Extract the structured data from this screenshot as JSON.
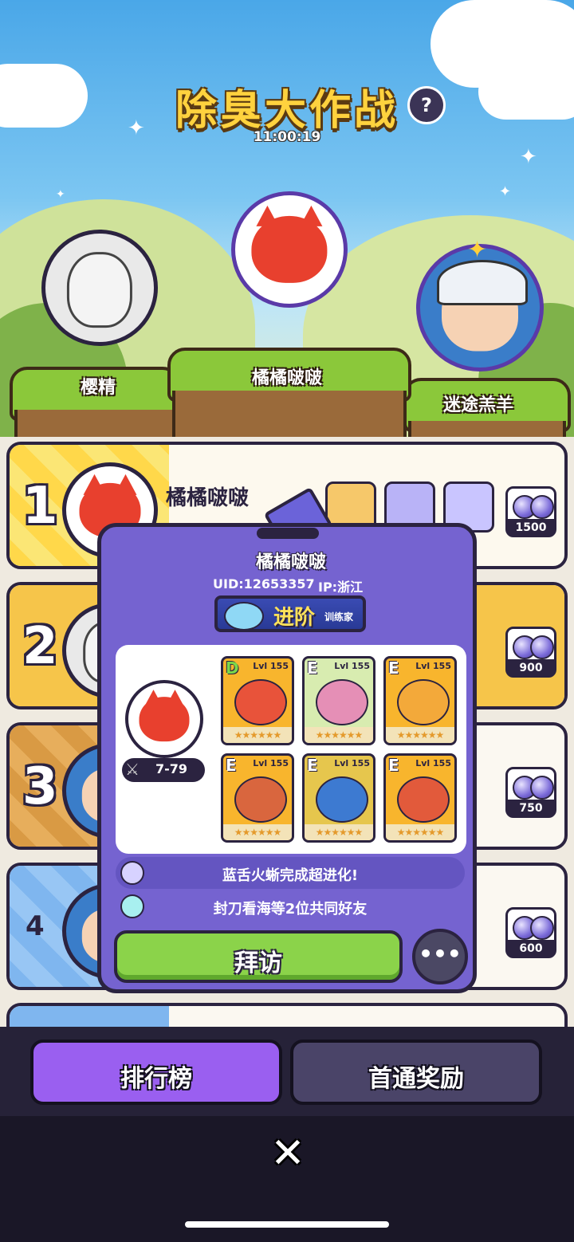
{
  "header": {
    "title": "除臭大作战",
    "help_label": "?",
    "timer": "11:00:19"
  },
  "podium": [
    {
      "place": 2,
      "name": "樱精",
      "avatar": "sketch-face"
    },
    {
      "place": 1,
      "name": "橘橘啵啵",
      "avatar": "red-fox"
    },
    {
      "place": 3,
      "name": "迷途羔羊",
      "avatar": "cap-boy"
    }
  ],
  "leaderboard": {
    "rows": [
      {
        "rank": "1",
        "name": "橘橘啵啵",
        "reward_amount": "1500"
      },
      {
        "rank": "2",
        "name": "",
        "reward_amount": "900"
      },
      {
        "rank": "3",
        "name": "",
        "reward_amount": "750"
      },
      {
        "rank": "4",
        "name": "",
        "reward_amount": "600"
      }
    ]
  },
  "popup": {
    "name": "橘橘啵啵",
    "uid": "UID:12653357",
    "ip": "IP:浙江",
    "badge_main": "进阶",
    "badge_sub": "训练家",
    "level": "7-79",
    "pets": [
      {
        "grade": "D",
        "level": "Lvl 155",
        "stars": "★★★★★★"
      },
      {
        "grade": "E",
        "level": "Lvl 155",
        "stars": "★★★★★★"
      },
      {
        "grade": "E",
        "level": "Lvl 155",
        "stars": "★★★★★★"
      },
      {
        "grade": "E",
        "level": "Lvl 155",
        "stars": "★★★★★★"
      },
      {
        "grade": "E",
        "level": "Lvl 155",
        "stars": "★★★★★★"
      },
      {
        "grade": "E",
        "level": "Lvl 155",
        "stars": "★★★★★★"
      }
    ],
    "news": "蓝舌火蜥完成超进化!",
    "friends": "封刀看海等2位共同好友",
    "visit_label": "拜访",
    "more_label": "•••"
  },
  "tabs": {
    "ranking": "排行榜",
    "first_clear": "首通奖励"
  },
  "close_label": "✕",
  "colors": {
    "accent_purple": "#9a5ff0",
    "popup_bg": "#7563d0",
    "visit_green": "#8bd34a",
    "title_yellow": "#ffd23e"
  }
}
